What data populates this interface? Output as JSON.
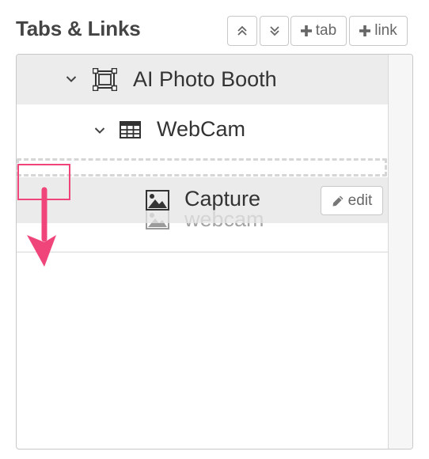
{
  "header": {
    "title": "Tabs & Links"
  },
  "toolbar": {
    "collapse_all_icon": "double-chevron-up-icon",
    "expand_all_icon": "double-chevron-down-icon",
    "add_tab_label": "tab",
    "add_link_label": "link"
  },
  "tree": {
    "nodes": [
      {
        "label": "AI Photo Booth",
        "icon": "frame-icon",
        "expanded": true
      },
      {
        "label": "WebCam",
        "icon": "grid-icon",
        "expanded": true
      },
      {
        "label": "Capture",
        "icon": "image-icon",
        "dragging": true,
        "edit_label": "edit"
      },
      {
        "label": "webcam",
        "icon": "image-icon"
      }
    ]
  },
  "colors": {
    "accent_drag": "#f0457a",
    "selected_row": "#ececec",
    "border": "#c8c8c8"
  }
}
